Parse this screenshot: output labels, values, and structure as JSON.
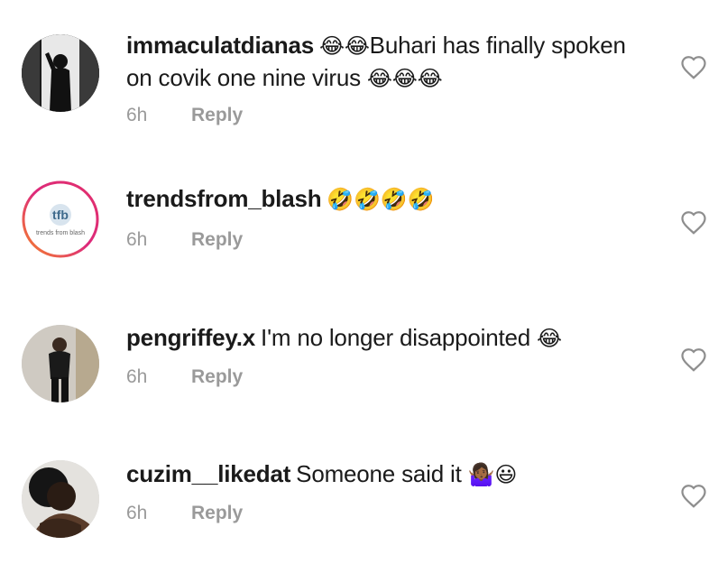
{
  "comments": [
    {
      "username": "immaculatdianas",
      "text_before": "",
      "emoji_before": "😂😂",
      "text": "Buhari has finally spoken on covik one nine virus ",
      "emoji_after": "😂😂😂",
      "time": "6h",
      "reply": "Reply"
    },
    {
      "username": "trendsfrom_blash",
      "text_before": "",
      "emoji_before": "🤣🤣🤣🤣",
      "text": "",
      "emoji_after": "",
      "time": "6h",
      "reply": "Reply",
      "avatar_logo": "tfb",
      "avatar_caption": "trends from blash"
    },
    {
      "username": "pengriffey.x",
      "text_before": "",
      "emoji_before": "",
      "text": "I'm no longer disappointed ",
      "emoji_after": "😂",
      "time": "6h",
      "reply": "Reply"
    },
    {
      "username": "cuzim__likedat",
      "text_before": "",
      "emoji_before": "",
      "text": "Someone said it ",
      "emoji_after": "🤷🏾‍♀️😃",
      "time": "6h",
      "reply": "Reply"
    }
  ],
  "colors": {
    "meta": "#9a9a9a",
    "heart": "#8e8e8e",
    "ring_start": "#f58529",
    "ring_end": "#dd2a7b"
  },
  "icons": {
    "like": "heart-outline-icon"
  }
}
